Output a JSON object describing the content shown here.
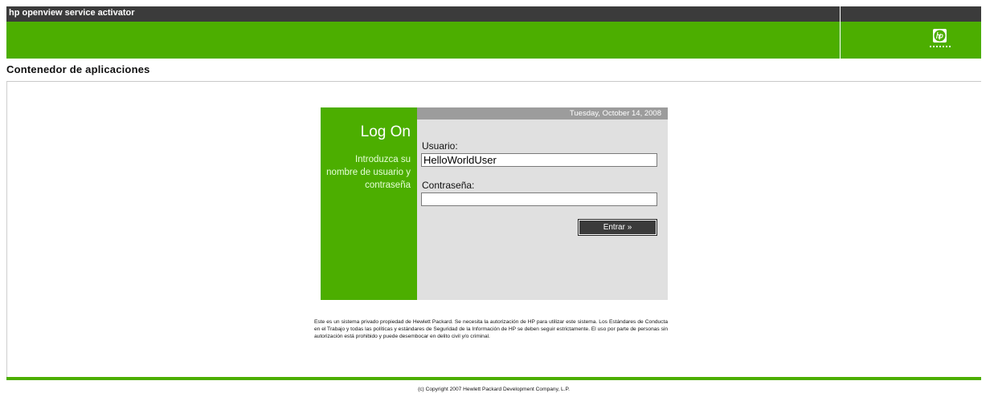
{
  "header": {
    "app_title": "hp openview service activator",
    "logo_icon": "hp-logo-icon"
  },
  "page": {
    "section_title": "Contenedor de aplicaciones"
  },
  "logon": {
    "title": "Log On",
    "instructions": "Introduzca su nombre de usuario y contraseña",
    "date": "Tuesday, October 14, 2008",
    "username_label": "Usuario:",
    "username_value": "HelloWorldUser",
    "password_label": "Contraseña:",
    "password_value": "",
    "submit_label": "Entrar »"
  },
  "disclaimer": "Este es un sistema privado propiedad de Hewlett Packard. Se necesita la autorización de HP para utilizar este sistema. Los Estándares de Conducta en el Trabajo y todas las políticas y estándares de Seguridad de la Información de HP se deben seguir estrictamente. El uso por parte de personas sin autorización está prohibido y puede desembocar en delito civil y/o criminal.",
  "footer": {
    "copyright": "(c) Copyright 2007 Hewlett Packard Development Company, L.P."
  },
  "colors": {
    "brand_green": "#4cae00",
    "dark_bar": "#3b3b3b",
    "form_bg": "#e0e0e0",
    "date_strip": "#9c9c9c"
  }
}
